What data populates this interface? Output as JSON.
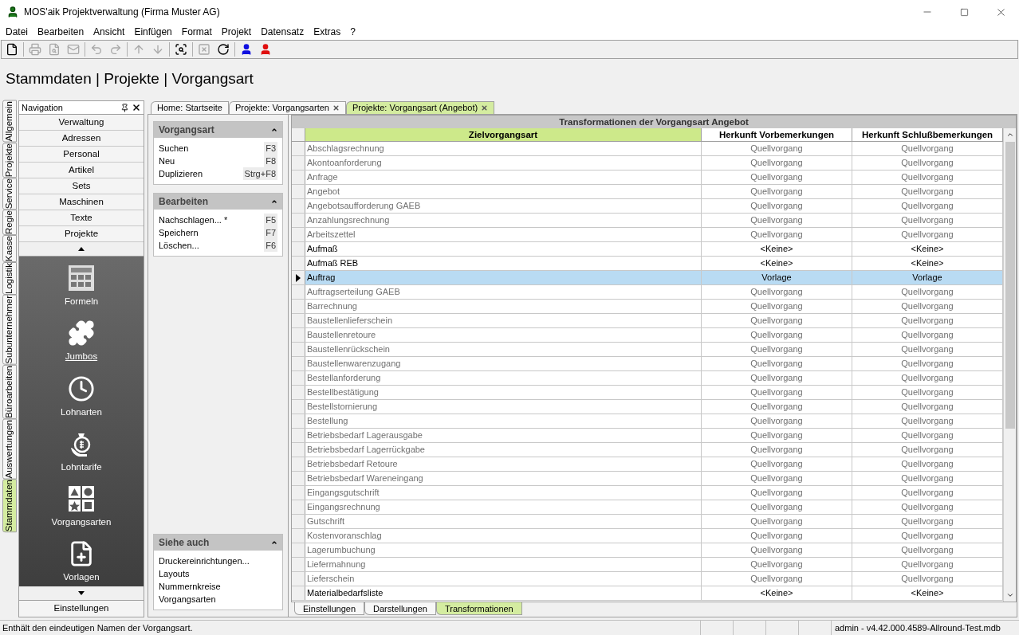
{
  "window": {
    "title": "MOS'aik Projektverwaltung (Firma Muster AG)"
  },
  "menu": [
    "Datei",
    "Bearbeiten",
    "Ansicht",
    "Einfügen",
    "Format",
    "Projekt",
    "Datensatz",
    "Extras",
    "?"
  ],
  "toolbar": [
    {
      "kind": "new",
      "disabled": false
    },
    {
      "kind": "separator"
    },
    {
      "kind": "print",
      "disabled": true
    },
    {
      "kind": "preview",
      "disabled": true
    },
    {
      "kind": "mail",
      "disabled": true
    },
    {
      "kind": "separator"
    },
    {
      "kind": "undo",
      "disabled": true
    },
    {
      "kind": "redo",
      "disabled": true
    },
    {
      "kind": "separator"
    },
    {
      "kind": "up",
      "disabled": true
    },
    {
      "kind": "down",
      "disabled": true
    },
    {
      "kind": "separator"
    },
    {
      "kind": "find",
      "disabled": false
    },
    {
      "kind": "separator"
    },
    {
      "kind": "excel",
      "disabled": true
    },
    {
      "kind": "refresh",
      "disabled": false
    },
    {
      "kind": "separator"
    },
    {
      "kind": "login",
      "disabled": false
    },
    {
      "kind": "logout",
      "disabled": false
    }
  ],
  "breadcrumb": "Stammdaten | Projekte | Vorgangsart",
  "side_tabs": [
    {
      "label": "Allgemein",
      "selected": false
    },
    {
      "label": "Projekte",
      "selected": false
    },
    {
      "label": "Service",
      "selected": false
    },
    {
      "label": "Regie",
      "selected": false
    },
    {
      "label": "Kasse",
      "selected": false
    },
    {
      "label": "Logistik",
      "selected": false
    },
    {
      "label": "Subunternehmer",
      "selected": false
    },
    {
      "label": "Büroarbeiten",
      "selected": false
    },
    {
      "label": "Auswertungen",
      "selected": false
    },
    {
      "label": "Stammdaten",
      "selected": true
    }
  ],
  "navigation": {
    "title": "Navigation",
    "groups": [
      "Verwaltung",
      "Adressen",
      "Personal",
      "Artikel",
      "Sets",
      "Maschinen",
      "Texte",
      "Projekte"
    ],
    "items": [
      {
        "kind": "calculator",
        "label": "Formeln",
        "hovered": false
      },
      {
        "kind": "puzzle",
        "label": "Jumbos",
        "hovered": true
      },
      {
        "kind": "clock",
        "label": "Lohnarten",
        "hovered": false
      },
      {
        "kind": "moneybag",
        "label": "Lohntarife",
        "hovered": false
      },
      {
        "kind": "shapes",
        "label": "Vorgangsarten",
        "hovered": false
      },
      {
        "kind": "template",
        "label": "Vorlagen",
        "hovered": false
      }
    ],
    "footer": "Einstellungen"
  },
  "task_panels": [
    {
      "title": "Vorgangsart",
      "items": [
        {
          "label": "Suchen",
          "shortcut": "F3"
        },
        {
          "label": "Neu",
          "shortcut": "F8"
        },
        {
          "label": "Duplizieren",
          "shortcut": "Strg+F8"
        }
      ]
    },
    {
      "title": "Bearbeiten",
      "items": [
        {
          "label": "Nachschlagen... *",
          "shortcut": "F5"
        },
        {
          "label": "Speichern",
          "shortcut": "F7"
        },
        {
          "label": "Löschen...",
          "shortcut": "F6"
        }
      ]
    }
  ],
  "see_also": {
    "title": "Siehe auch",
    "items": [
      "Druckereinrichtungen...",
      "Layouts",
      "Nummernkreise",
      "Vorgangsarten"
    ]
  },
  "doc_tabs": [
    {
      "label": "Home: Startseite",
      "selected": false,
      "closable": false
    },
    {
      "label": "Projekte: Vorgangsarten",
      "selected": false,
      "closable": true
    },
    {
      "label": "Projekte: Vorgangsart (Angebot)",
      "selected": true,
      "closable": true
    }
  ],
  "grid": {
    "title": "Transformationen der Vorgangsart Angebot",
    "columns": [
      "Zielvorgangsart",
      "Herkunft Vorbemerkungen",
      "Herkunft Schlußbemerkungen"
    ],
    "rows": [
      {
        "cells": [
          "Abschlagsrechnung",
          "Quellvorgang",
          "Quellvorgang"
        ],
        "dimmed": true,
        "selected": false
      },
      {
        "cells": [
          "Akontoanforderung",
          "Quellvorgang",
          "Quellvorgang"
        ],
        "dimmed": true,
        "selected": false
      },
      {
        "cells": [
          "Anfrage",
          "Quellvorgang",
          "Quellvorgang"
        ],
        "dimmed": true,
        "selected": false
      },
      {
        "cells": [
          "Angebot",
          "Quellvorgang",
          "Quellvorgang"
        ],
        "dimmed": true,
        "selected": false
      },
      {
        "cells": [
          "Angebotsaufforderung GAEB",
          "Quellvorgang",
          "Quellvorgang"
        ],
        "dimmed": true,
        "selected": false
      },
      {
        "cells": [
          "Anzahlungsrechnung",
          "Quellvorgang",
          "Quellvorgang"
        ],
        "dimmed": true,
        "selected": false
      },
      {
        "cells": [
          "Arbeitszettel",
          "Quellvorgang",
          "Quellvorgang"
        ],
        "dimmed": true,
        "selected": false
      },
      {
        "cells": [
          "Aufmaß",
          "<Keine>",
          "<Keine>"
        ],
        "dimmed": false,
        "selected": false
      },
      {
        "cells": [
          "Aufmaß REB",
          "<Keine>",
          "<Keine>"
        ],
        "dimmed": false,
        "selected": false
      },
      {
        "cells": [
          "Auftrag",
          "Vorlage",
          "Vorlage"
        ],
        "dimmed": false,
        "selected": true
      },
      {
        "cells": [
          "Auftragserteilung GAEB",
          "Quellvorgang",
          "Quellvorgang"
        ],
        "dimmed": true,
        "selected": false
      },
      {
        "cells": [
          "Barrechnung",
          "Quellvorgang",
          "Quellvorgang"
        ],
        "dimmed": true,
        "selected": false
      },
      {
        "cells": [
          "Baustellenlieferschein",
          "Quellvorgang",
          "Quellvorgang"
        ],
        "dimmed": true,
        "selected": false
      },
      {
        "cells": [
          "Baustellenretoure",
          "Quellvorgang",
          "Quellvorgang"
        ],
        "dimmed": true,
        "selected": false
      },
      {
        "cells": [
          "Baustellenrückschein",
          "Quellvorgang",
          "Quellvorgang"
        ],
        "dimmed": true,
        "selected": false
      },
      {
        "cells": [
          "Baustellenwarenzugang",
          "Quellvorgang",
          "Quellvorgang"
        ],
        "dimmed": true,
        "selected": false
      },
      {
        "cells": [
          "Bestellanforderung",
          "Quellvorgang",
          "Quellvorgang"
        ],
        "dimmed": true,
        "selected": false
      },
      {
        "cells": [
          "Bestellbestätigung",
          "Quellvorgang",
          "Quellvorgang"
        ],
        "dimmed": true,
        "selected": false
      },
      {
        "cells": [
          "Bestellstornierung",
          "Quellvorgang",
          "Quellvorgang"
        ],
        "dimmed": true,
        "selected": false
      },
      {
        "cells": [
          "Bestellung",
          "Quellvorgang",
          "Quellvorgang"
        ],
        "dimmed": true,
        "selected": false
      },
      {
        "cells": [
          "Betriebsbedarf Lagerausgabe",
          "Quellvorgang",
          "Quellvorgang"
        ],
        "dimmed": true,
        "selected": false
      },
      {
        "cells": [
          "Betriebsbedarf Lagerrückgabe",
          "Quellvorgang",
          "Quellvorgang"
        ],
        "dimmed": true,
        "selected": false
      },
      {
        "cells": [
          "Betriebsbedarf Retoure",
          "Quellvorgang",
          "Quellvorgang"
        ],
        "dimmed": true,
        "selected": false
      },
      {
        "cells": [
          "Betriebsbedarf Wareneingang",
          "Quellvorgang",
          "Quellvorgang"
        ],
        "dimmed": true,
        "selected": false
      },
      {
        "cells": [
          "Eingangsgutschrift",
          "Quellvorgang",
          "Quellvorgang"
        ],
        "dimmed": true,
        "selected": false
      },
      {
        "cells": [
          "Eingangsrechnung",
          "Quellvorgang",
          "Quellvorgang"
        ],
        "dimmed": true,
        "selected": false
      },
      {
        "cells": [
          "Gutschrift",
          "Quellvorgang",
          "Quellvorgang"
        ],
        "dimmed": true,
        "selected": false
      },
      {
        "cells": [
          "Kostenvoranschlag",
          "Quellvorgang",
          "Quellvorgang"
        ],
        "dimmed": true,
        "selected": false
      },
      {
        "cells": [
          "Lagerumbuchung",
          "Quellvorgang",
          "Quellvorgang"
        ],
        "dimmed": true,
        "selected": false
      },
      {
        "cells": [
          "Liefermahnung",
          "Quellvorgang",
          "Quellvorgang"
        ],
        "dimmed": true,
        "selected": false
      },
      {
        "cells": [
          "Lieferschein",
          "Quellvorgang",
          "Quellvorgang"
        ],
        "dimmed": true,
        "selected": false
      },
      {
        "cells": [
          "Materialbedarfsliste",
          "<Keine>",
          "<Keine>"
        ],
        "dimmed": false,
        "selected": false
      }
    ]
  },
  "bottom_tabs": [
    {
      "label": "Einstellungen",
      "selected": false
    },
    {
      "label": "Darstellungen",
      "selected": false
    },
    {
      "label": "Transformationen",
      "selected": true
    }
  ],
  "status_bar": {
    "message": "Enthält den eindeutigen Namen der Vorgangsart.",
    "info": "admin - v4.42.000.4589-Allround-Test.mdb"
  }
}
